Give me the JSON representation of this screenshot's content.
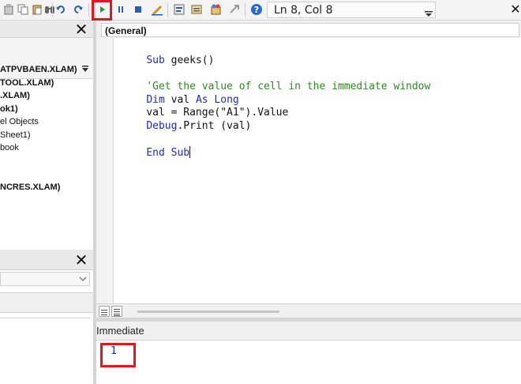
{
  "toolbar": {
    "position_text": "Ln 8, Col 8",
    "icons": [
      "delete-icon",
      "copy-icon",
      "paste-icon",
      "find-icon",
      "undo-icon",
      "redo-icon",
      "run-icon",
      "break-icon",
      "reset-icon",
      "design-mode-icon",
      "project-explorer-icon",
      "properties-icon",
      "object-browser-icon",
      "toolbox-icon",
      "help-icon",
      "close-icon"
    ]
  },
  "project_explorer": {
    "items": [
      {
        "label": "ATPVBAEN.XLAM)",
        "bold": true
      },
      {
        "label": "TOOL.XLAM)",
        "bold": true
      },
      {
        "label": ".XLAM)",
        "bold": true
      },
      {
        "label": "ok1)",
        "bold": true
      },
      {
        "label": "el Objects",
        "bold": false
      },
      {
        "label": "Sheet1)",
        "bold": false
      },
      {
        "label": "book",
        "bold": false
      },
      {
        "label": "NCRES.XLAM)",
        "bold": true
      }
    ]
  },
  "code": {
    "object_combo": "(General)",
    "lines": {
      "l1_kw": "Sub",
      "l1_rest": " geeks()",
      "l3_comment": "'Get the value of cell in the immediate window",
      "l4_kw1": "Dim",
      "l4_mid": " val ",
      "l4_kw2": "As Long",
      "l5": "val = Range(\"A1\").Value",
      "l6_kw": "Debug",
      "l6_rest": ".Print (val)",
      "l8_kw": "End Sub"
    }
  },
  "immediate": {
    "title": "Immediate",
    "value": "1"
  },
  "colors": {
    "highlight": "#e3171b",
    "keyword": "#1f2db2",
    "comment": "#2f8a1f"
  }
}
